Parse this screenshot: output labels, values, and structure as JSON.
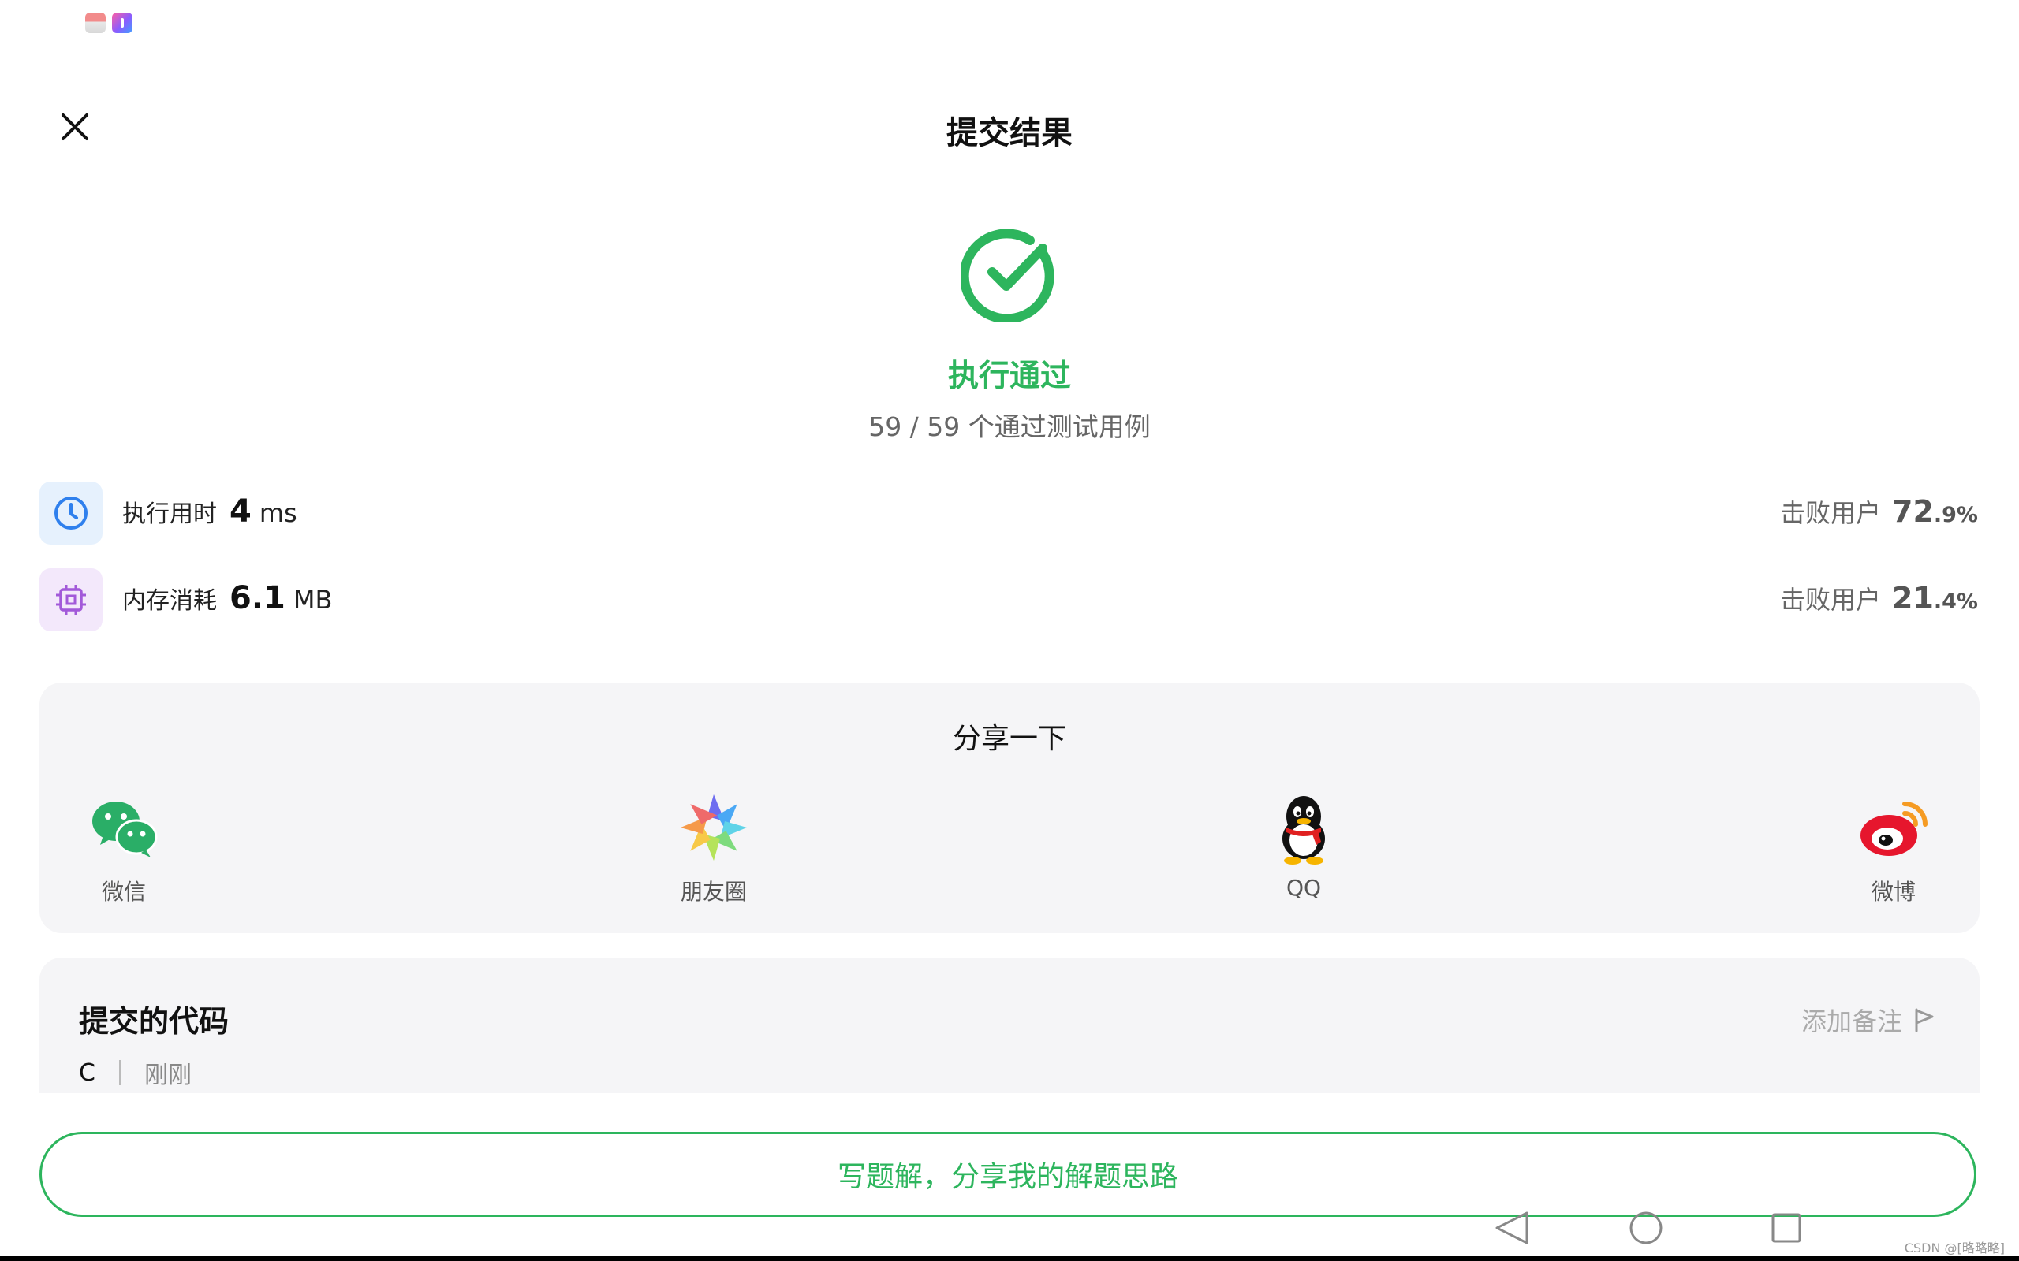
{
  "header": {
    "title": "提交结果"
  },
  "result": {
    "status": "执行通过",
    "passed": "59",
    "total": "59",
    "detail": "59 / 59 个通过测试用例",
    "accent_color": "#2db55d"
  },
  "metrics": {
    "time": {
      "label": "执行用时",
      "value": "4",
      "unit": "ms",
      "beat_label": "击败用户",
      "beat_pct_int": "72",
      "beat_pct_dec": ".9%",
      "icon": "clock-icon"
    },
    "memory": {
      "label": "内存消耗",
      "value": "6.1",
      "unit": "MB",
      "beat_label": "击败用户",
      "beat_pct_int": "21",
      "beat_pct_dec": ".4%",
      "icon": "chip-icon"
    }
  },
  "share": {
    "title": "分享一下",
    "items": [
      {
        "label": "微信",
        "icon": "wechat-icon"
      },
      {
        "label": "朋友圈",
        "icon": "moments-icon"
      },
      {
        "label": "QQ",
        "icon": "qq-icon"
      },
      {
        "label": "微博",
        "icon": "weibo-icon"
      }
    ]
  },
  "code": {
    "title": "提交的代码",
    "add_note": "添加备注",
    "language": "C",
    "time": "刚刚"
  },
  "actions": {
    "solution_button": "写题解，分享我的解题思路"
  },
  "footer": {
    "watermark": "CSDN @[略略略]"
  }
}
